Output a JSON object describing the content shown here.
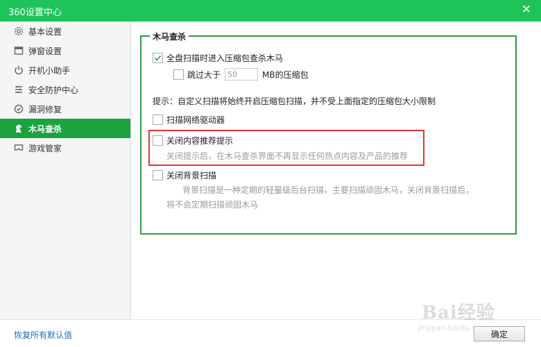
{
  "window": {
    "title": "360设置中心",
    "close_glyph": "✕"
  },
  "sidebar": {
    "items": [
      {
        "label": "基本设置",
        "icon": "gear-icon",
        "active": false
      },
      {
        "label": "弹窗设置",
        "icon": "window-icon",
        "active": false
      },
      {
        "label": "开机小助手",
        "icon": "power-icon",
        "active": false
      },
      {
        "label": "安全防护中心",
        "icon": "shield-grid-icon",
        "active": false
      },
      {
        "label": "漏洞修复",
        "icon": "patch-icon",
        "active": false
      },
      {
        "label": "木马查杀",
        "icon": "horse-icon",
        "active": true
      },
      {
        "label": "游戏管家",
        "icon": "game-icon",
        "active": false
      }
    ]
  },
  "panel": {
    "group_title": "木马查杀",
    "options": {
      "full_scan_compressed": {
        "label": "全盘扫描时进入压缩包查杀木马",
        "checked": true
      },
      "skip_larger": {
        "label_before": "跳过大于",
        "value": "50",
        "label_after": "MB的压缩包",
        "checked": false
      },
      "tip": "提示：自定义扫描将始终开启压缩包扫描，并不受上面指定的压缩包大小限制",
      "scan_network_driver": {
        "label": "扫描网络驱动器",
        "checked": false
      },
      "close_recommend": {
        "label": "关闭内容推荐提示",
        "checked": false,
        "desc": "关闭提示后，在木马查杀界面不再显示任何热点内容及产品的推荐"
      },
      "close_background_scan": {
        "label": "关闭背景扫描",
        "checked": false,
        "desc_line1": "背景扫描是一种定期的轻量级后台扫描，主要扫描顽固木马，关闭背景扫描后，",
        "desc_line2": "将不会定期扫描顽固木马"
      }
    }
  },
  "footer": {
    "restore_label": "恢复所有默认值",
    "ok_label": "确定"
  },
  "watermark": {
    "text": "Bai经验",
    "sub": "jingyan.baidu.com"
  },
  "colors": {
    "titlebar": "#1ec45a",
    "active_item": "#1aa33f",
    "group_border": "#2e9a3f",
    "highlight": "#e5313a",
    "link": "#1d6fb8"
  }
}
